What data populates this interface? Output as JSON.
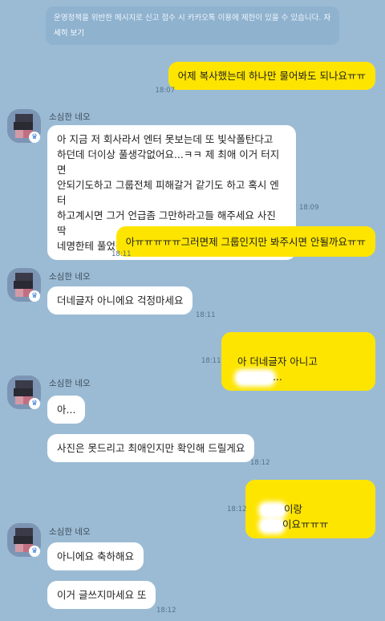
{
  "notice": {
    "text": "운영정책을 위반한 메시지로 신고 접수 시 카카오톡 이용에 제한이 있을 수 있습니다.",
    "more": "자세히 보기"
  },
  "sender": {
    "name": "소심한 네오",
    "avatar_icon": "pixelated-avatar-icon",
    "badge_icon": "crown-badge-icon"
  },
  "messages": [
    {
      "from": "me",
      "text": "어제 복사했는데 하나만 물어봐도 되나요ㅠㅠ",
      "time": "18:07"
    },
    {
      "from": "them",
      "text": "아 지금 저 회사라서 엔터 못보는데 또 빛삭폴탄다고\n하던데 더이상 풀생각없어요...ㅋㅋ 제 최애 이거 터지면\n안되기도하고 그룹전체 피해갈거 같기도 하고 혹시 엔터\n하고계시면 그거 언급좀 그만하라고들 해주세요 사진 딱\n네명한테 풀었는데 아는척도 그만하라고 해주시고요",
      "time": "18:09"
    },
    {
      "from": "me",
      "text": "아ㅠㅠㅠㅠㅠ그러면제 그룹인지만 봐주시면 안될까요ㅠㅠ",
      "time": "18:11"
    },
    {
      "from": "them",
      "text": "더네글자 아니에요 걱정마세요",
      "time": "18:11"
    },
    {
      "from": "me",
      "text_before": "아 더네글자 아니고",
      "text_after": "...",
      "time": "18:11"
    },
    {
      "from": "them",
      "text": "아...",
      "time": ""
    },
    {
      "from": "them",
      "text": "사진은 못드리고 최애인지만 확인해 드릴게요",
      "time": "18:12"
    },
    {
      "from": "me",
      "text_a": "이랑",
      "text_b": "이요ㅠㅠㅠ",
      "time": "18:12"
    },
    {
      "from": "them",
      "text": "아니에요 축하해요",
      "time": ""
    },
    {
      "from": "them",
      "text": "이거 글쓰지마세요 또",
      "time": "18:12"
    }
  ],
  "colors": {
    "background": "#9bbbd4",
    "my_bubble": "#fee500",
    "their_bubble": "#ffffff"
  }
}
